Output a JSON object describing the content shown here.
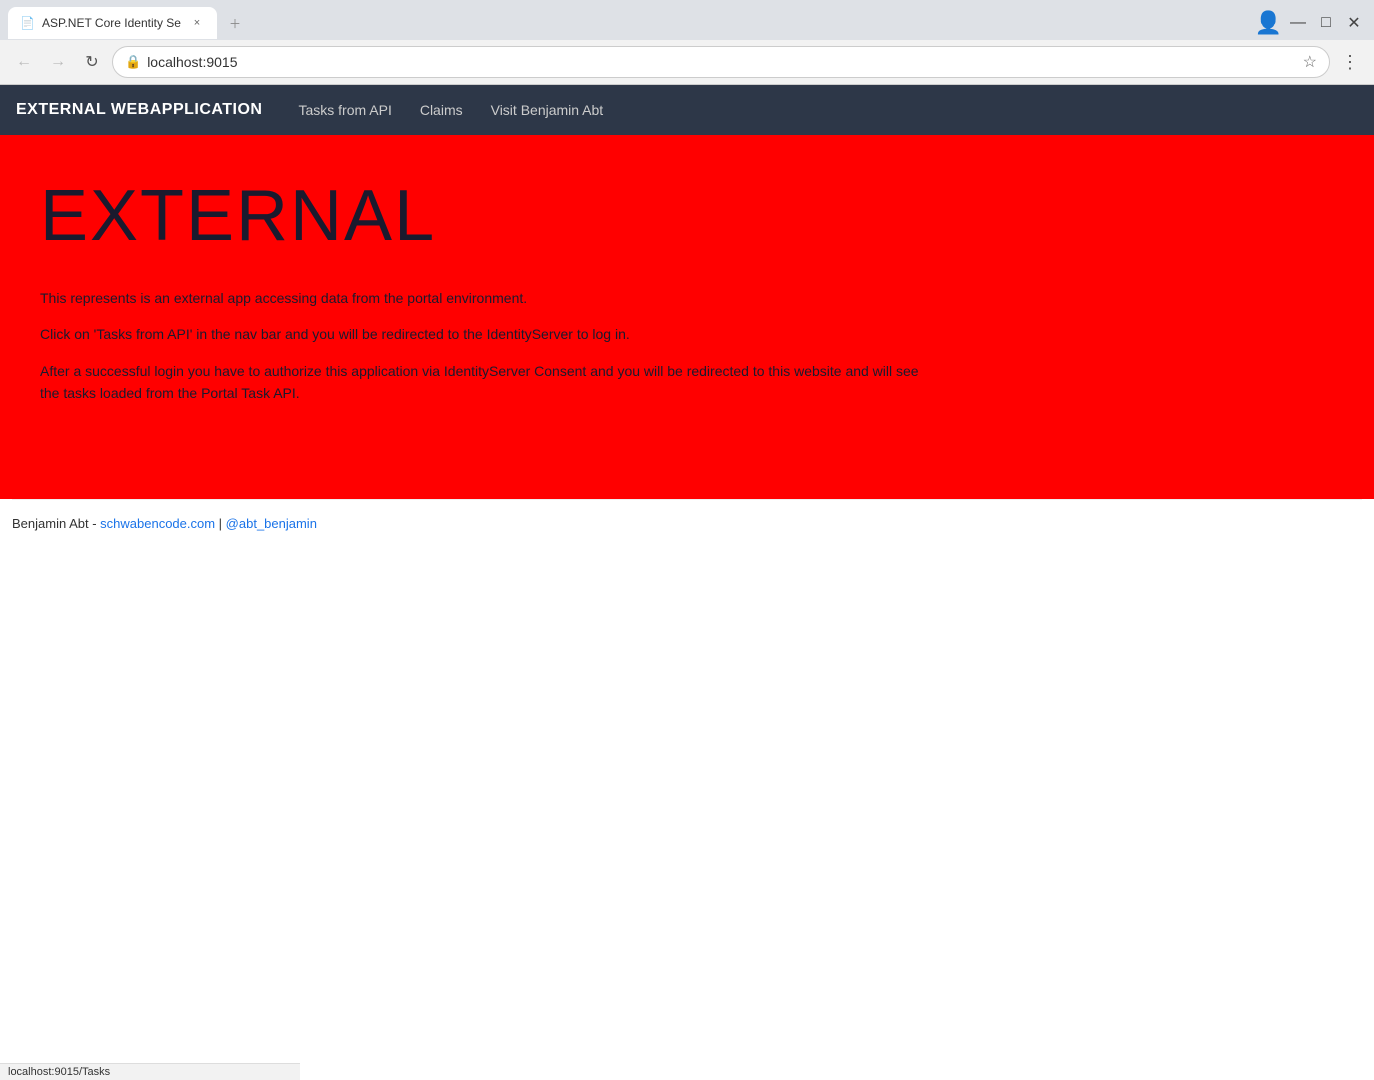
{
  "browser": {
    "tab": {
      "title": "ASP.NET Core Identity Se",
      "favicon": "📄",
      "close_label": "×",
      "inactive_label": ""
    },
    "window_controls": {
      "minimize": "—",
      "maximize": "□",
      "close": "✕"
    },
    "toolbar": {
      "back_btn": "←",
      "forward_btn": "→",
      "reload_btn": "↻",
      "url": "localhost:9015",
      "star": "☆",
      "menu": "⋮",
      "profile_icon": "👤"
    }
  },
  "navbar": {
    "brand": "EXTERNAL WEBAPPLICATION",
    "links": [
      {
        "label": "Tasks from API",
        "href": "#"
      },
      {
        "label": "Claims",
        "href": "#"
      },
      {
        "label": "Visit Benjamin Abt",
        "href": "#"
      }
    ]
  },
  "hero": {
    "title": "EXTERNAL",
    "paragraphs": [
      "This represents is an external app accessing data from the portal environment.",
      "Click on 'Tasks from API' in the nav bar and you will be redirected to the IdentityServer to log in.",
      "After a successful login you have to authorize this application via IdentityServer Consent and you will be redirected to this website and will see the tasks loaded from the Portal Task API."
    ]
  },
  "footer": {
    "prefix": "Benjamin Abt - ",
    "link1_text": "schwabencode.com",
    "link1_href": "#",
    "separator": " | ",
    "link2_text": "@abt_benjamin",
    "link2_href": "#"
  },
  "status_bar": {
    "url": "localhost:9015/Tasks"
  }
}
